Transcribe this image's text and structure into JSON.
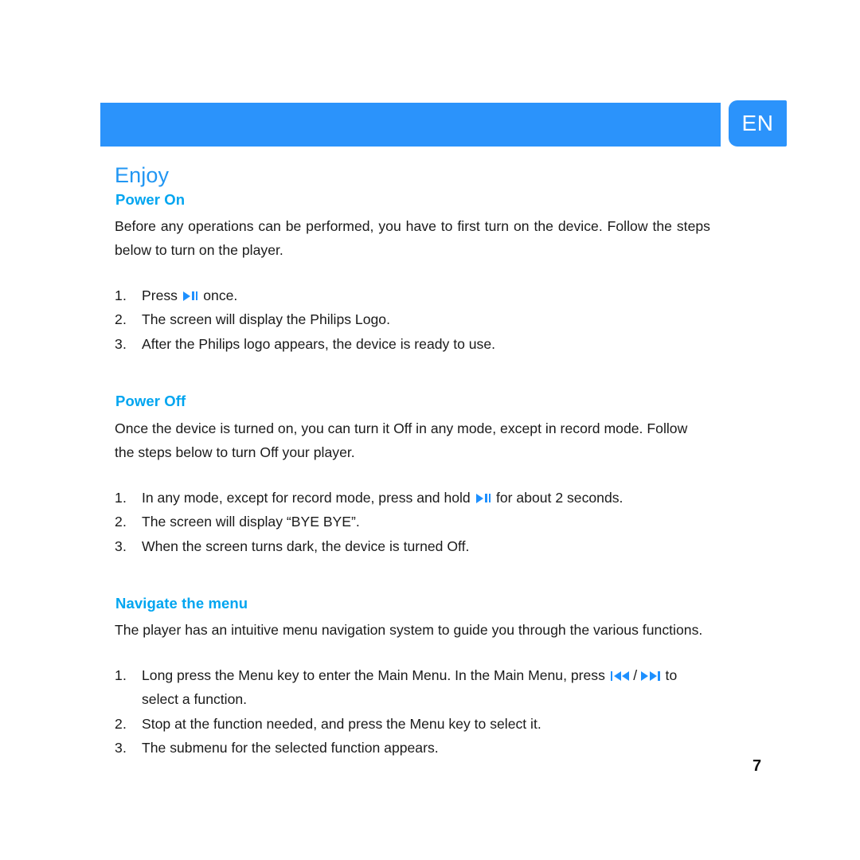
{
  "header": {
    "language_tab": "EN",
    "band_color": "#2b93fb",
    "heading_color": "#00a5f0",
    "title_color": "#2196f3"
  },
  "page": {
    "title": "Enjoy",
    "number": "7"
  },
  "sections": [
    {
      "heading": "Power On",
      "intro": "Before any operations can be performed, you have to first turn on the device. Follow the steps below to turn on the player.",
      "steps": [
        {
          "num": "1.",
          "before": "Press ",
          "icon": "play-pause-icon",
          "after": " once."
        },
        {
          "num": "2.",
          "before": "The screen will display the Philips Logo.",
          "icon": null,
          "after": ""
        },
        {
          "num": "3.",
          "before": "After the Philips logo appears, the device is ready to use.",
          "icon": null,
          "after": ""
        }
      ]
    },
    {
      "heading": "Power Off",
      "intro": "Once the device is turned on, you can turn it Off in any mode, except in record mode. Follow the steps below to turn Off your player.",
      "steps": [
        {
          "num": "1.",
          "before": "In any mode, except for record mode, press and hold ",
          "icon": "play-pause-icon",
          "after": " for about 2 seconds."
        },
        {
          "num": "2.",
          "before": "The screen will display “BYE BYE”.",
          "icon": null,
          "after": ""
        },
        {
          "num": "3.",
          "before": "When the screen turns dark, the device is turned Off.",
          "icon": null,
          "after": ""
        }
      ]
    },
    {
      "heading": "Navigate the menu",
      "intro": "The player has an intuitive menu navigation system to guide you through the various functions.",
      "steps": [
        {
          "num": "1.",
          "before": "Long press the Menu key to enter the Main Menu. In the Main Menu, press ",
          "icon": "prev-next-track-icon",
          "after": " to select a function."
        },
        {
          "num": "2.",
          "before": "Stop at the function needed, and press the Menu key to select it.",
          "icon": null,
          "after": ""
        },
        {
          "num": "3.",
          "before": "The submenu for the selected function appears.",
          "icon": null,
          "after": ""
        }
      ]
    }
  ],
  "icon_separator": "/"
}
